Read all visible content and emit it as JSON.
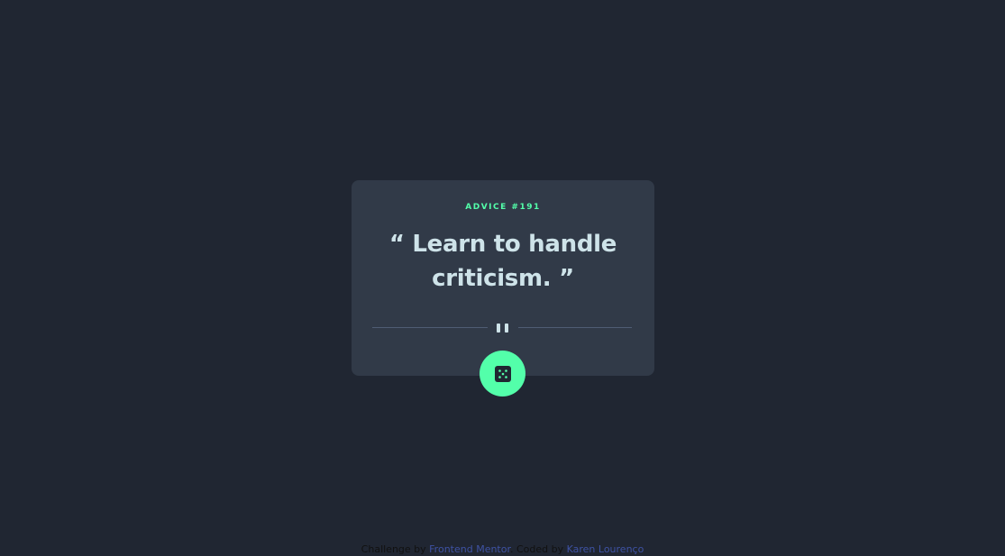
{
  "card": {
    "advice_label": "ADVICE #191",
    "quote": "“ Learn to handle criticism. ”"
  },
  "icons": {
    "divider": "pause-icon",
    "button": "dice-icon"
  },
  "attribution": {
    "prefix": "Challenge by",
    "challenge_link": "Frontend Mentor",
    "separator": ". Coded by",
    "author_link": "Karen Lourenço"
  },
  "colors": {
    "background": "#202632",
    "card": "#313a48",
    "accent": "#53ffaa",
    "quote_text": "#cee3e9",
    "divider": "#4f5d74",
    "link": "#3e52a3"
  }
}
